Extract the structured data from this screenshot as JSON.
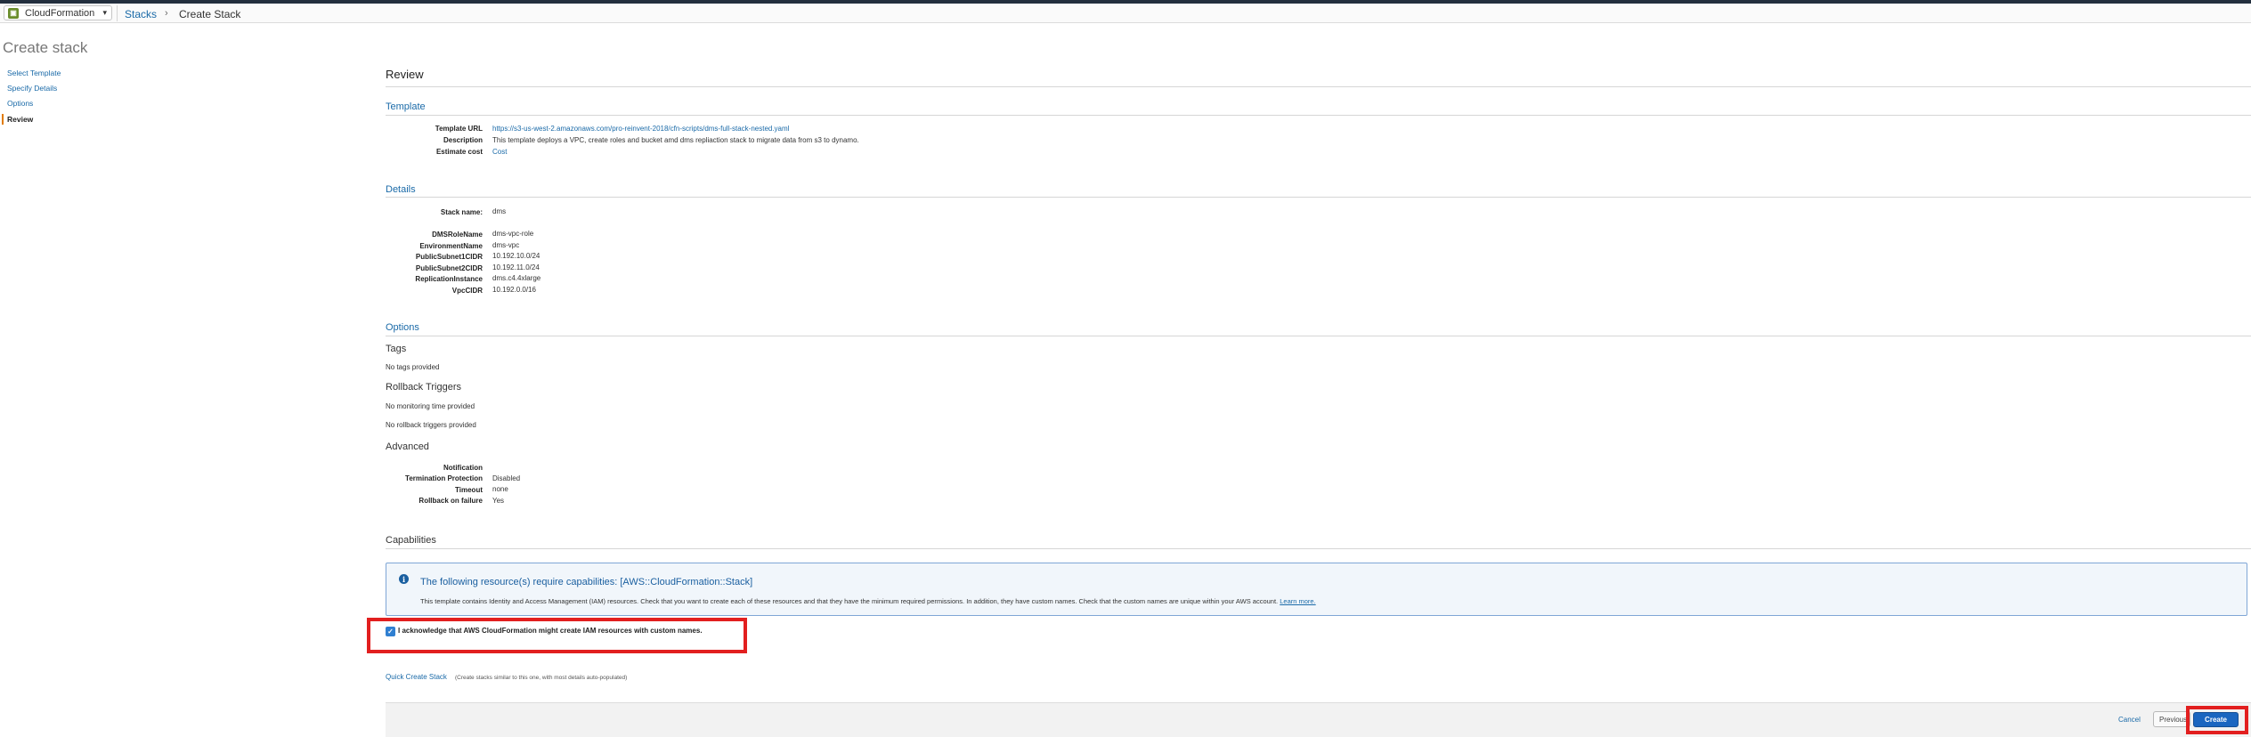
{
  "header": {
    "service_label": "CloudFormation",
    "breadcrumb_stacks": "Stacks",
    "breadcrumb_current": "Create Stack"
  },
  "left_nav": {
    "title": "Create stack",
    "items": [
      {
        "label": "Select Template"
      },
      {
        "label": "Specify Details"
      },
      {
        "label": "Options"
      },
      {
        "label": "Review"
      }
    ]
  },
  "review": {
    "heading": "Review",
    "template": {
      "heading": "Template",
      "rows": [
        {
          "key": "Template URL",
          "value": "https://s3-us-west-2.amazonaws.com/pro-reinvent-2018/cfn-scripts/dms-full-stack-nested.yaml"
        },
        {
          "key": "Description",
          "value": "This template deploys a VPC, create roles and bucket amd dms repliaction stack to migrate data from s3 to dynamo."
        },
        {
          "key": "Estimate cost",
          "value": "Cost"
        }
      ]
    },
    "details": {
      "heading": "Details",
      "stack_name_key": "Stack name:",
      "stack_name_value": "dms",
      "params": [
        {
          "key": "DMSRoleName",
          "value": "dms-vpc-role"
        },
        {
          "key": "EnvironmentName",
          "value": "dms-vpc"
        },
        {
          "key": "PublicSubnet1CIDR",
          "value": "10.192.10.0/24"
        },
        {
          "key": "PublicSubnet2CIDR",
          "value": "10.192.11.0/24"
        },
        {
          "key": "ReplicationInstance",
          "value": "dms.c4.4xlarge"
        },
        {
          "key": "VpcCIDR",
          "value": "10.192.0.0/16"
        }
      ]
    },
    "options": {
      "heading": "Options",
      "tags_heading": "Tags",
      "tags_text": "No tags provided",
      "rollback_heading": "Rollback Triggers",
      "monitoring_text": "No monitoring time provided",
      "rollback_text": "No rollback triggers provided",
      "advanced_heading": "Advanced",
      "advanced": [
        {
          "key": "Notification",
          "value": ""
        },
        {
          "key": "Termination Protection",
          "value": "Disabled"
        },
        {
          "key": "Timeout",
          "value": "none"
        },
        {
          "key": "Rollback on failure",
          "value": "Yes"
        }
      ]
    },
    "capabilities": {
      "heading": "Capabilities",
      "box_title": "The following resource(s) require capabilities: [AWS::CloudFormation::Stack]",
      "box_text": "This template contains Identity and Access Management (IAM) resources. Check that you want to create each of these resources and that they have the minimum required permissions. In addition, they have custom names. Check that the custom names are unique within your AWS account.",
      "learn_more": "Learn more.",
      "acknowledge": "I acknowledge that AWS CloudFormation might create IAM resources with custom names.",
      "acknowledge_checked": true
    },
    "quick_create": {
      "link": "Quick Create Stack",
      "note": "(Create stacks similar to this one, with most details auto-populated)"
    }
  },
  "footer": {
    "cancel": "Cancel",
    "previous": "Previous",
    "create": "Create"
  },
  "colors": {
    "link": "#1a6aa8",
    "primary_button": "#1a66c0",
    "highlight": "#e21f1f",
    "info_box_bg": "#f1f6fb"
  }
}
